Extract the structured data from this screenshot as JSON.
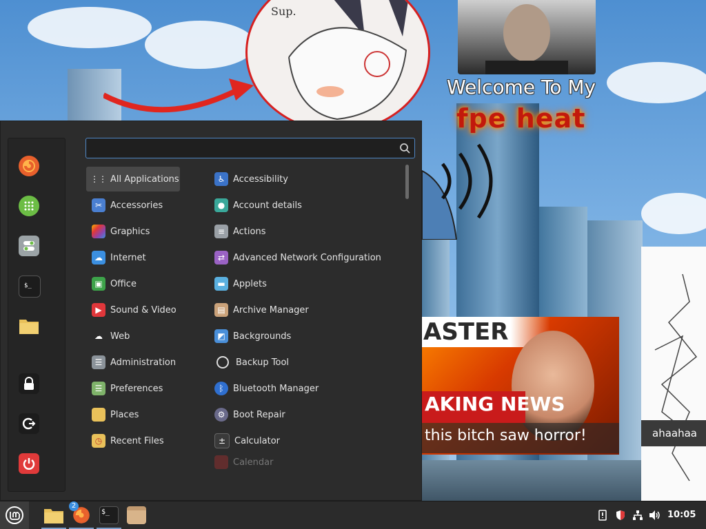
{
  "wallpaper": {
    "sketch_text": "Sup.",
    "welcome_text": "Welcome To My",
    "fire_text": "fpe heat",
    "news_top": "ASTER",
    "news_red": "AKING NEWS",
    "news_caption": "this bitch saw horror!",
    "side_caption": "ahaahaa"
  },
  "menu": {
    "search_value": "",
    "favorites": [
      {
        "name": "firefox",
        "icon": "firefox-icon",
        "color": "#e8602c"
      },
      {
        "name": "software-manager",
        "icon": "grid-icon",
        "color": "#6cbd45"
      },
      {
        "name": "settings",
        "icon": "toggle-icon",
        "color": "#9ba3a6"
      },
      {
        "name": "terminal",
        "icon": "terminal-icon",
        "color": "#202020"
      },
      {
        "name": "files",
        "icon": "folder-icon",
        "color": "#e9c15a"
      },
      {
        "name": "lock",
        "icon": "lock-icon",
        "color": "#202020"
      },
      {
        "name": "logout",
        "icon": "logout-icon",
        "color": "#202020"
      },
      {
        "name": "shutdown",
        "icon": "power-icon",
        "color": "#e03a3a"
      }
    ],
    "categories": [
      {
        "label": "All Applications",
        "icon": "grid-dots-icon",
        "color": "#484848"
      },
      {
        "label": "Accessories",
        "icon": "scissors-icon",
        "color": "#4a7fd1"
      },
      {
        "label": "Graphics",
        "icon": "palette-icon",
        "color": "#c8509c"
      },
      {
        "label": "Internet",
        "icon": "cloud-icon",
        "color": "#3b8fe0"
      },
      {
        "label": "Office",
        "icon": "office-icon",
        "color": "#3da34a"
      },
      {
        "label": "Sound & Video",
        "icon": "play-icon",
        "color": "#e0373b"
      },
      {
        "label": "Web",
        "icon": "cloud-icon",
        "color": "#2c2c2c"
      },
      {
        "label": "Administration",
        "icon": "sliders-icon",
        "color": "#8b939a"
      },
      {
        "label": "Preferences",
        "icon": "sliders-icon",
        "color": "#7fb36a"
      },
      {
        "label": "Places",
        "icon": "folder-icon",
        "color": "#e9c15a"
      },
      {
        "label": "Recent Files",
        "icon": "folder-clock-icon",
        "color": "#e9c15a"
      }
    ],
    "apps": [
      {
        "label": "Accessibility",
        "icon": "accessibility-icon",
        "color": "#3b73c8"
      },
      {
        "label": "Account details",
        "icon": "user-icon",
        "color": "#3aa89a"
      },
      {
        "label": "Actions",
        "icon": "list-icon",
        "color": "#9aa0a6"
      },
      {
        "label": "Advanced Network Configuration",
        "icon": "network-icon",
        "color": "#9a62c4"
      },
      {
        "label": "Applets",
        "icon": "applet-icon",
        "color": "#5ab0e0"
      },
      {
        "label": "Archive Manager",
        "icon": "box-icon",
        "color": "#caa27a"
      },
      {
        "label": "Backgrounds",
        "icon": "image-icon",
        "color": "#4a8fd9"
      },
      {
        "label": "Backup Tool",
        "icon": "backup-icon",
        "color": "#2c2c2c"
      },
      {
        "label": "Bluetooth Manager",
        "icon": "bluetooth-icon",
        "color": "#2f6fcf"
      },
      {
        "label": "Boot Repair",
        "icon": "boot-icon",
        "color": "#6a6a8a"
      },
      {
        "label": "Calculator",
        "icon": "calculator-icon",
        "color": "#3a3a3a"
      },
      {
        "label": "Calendar",
        "icon": "calendar-icon",
        "color": "#d33",
        "faded": true
      }
    ]
  },
  "panel": {
    "firefox_badge": "2",
    "clock": "10:05"
  }
}
